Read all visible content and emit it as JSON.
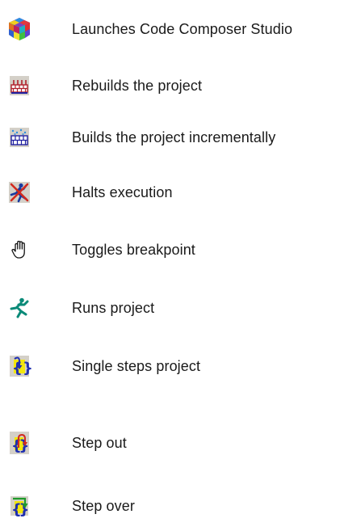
{
  "legend": {
    "items": [
      {
        "icon": "code-composer-studio-cube-icon",
        "label": "Launches Code Composer Studio"
      },
      {
        "icon": "rebuild-all-icon",
        "label": "Rebuilds the project"
      },
      {
        "icon": "incremental-build-icon",
        "label": "Builds the project incrementally"
      },
      {
        "icon": "halt-icon",
        "label": "Halts execution"
      },
      {
        "icon": "toggle-breakpoint-hand-icon",
        "label": "Toggles breakpoint"
      },
      {
        "icon": "run-icon",
        "label": "Runs project"
      },
      {
        "icon": "single-step-icon",
        "label": "Single steps project"
      },
      {
        "icon": "step-out-icon",
        "label": "Step out"
      },
      {
        "icon": "step-over-icon",
        "label": "Step over"
      }
    ]
  },
  "colors": {
    "text": "#1a1a1a",
    "icon_background": "#d4d0c8",
    "run_green": "#0a8a78",
    "step_yellow": "#f2e60c",
    "step_blue": "#1f2fb0",
    "arrow_red": "#d22a1e",
    "arrow_green": "#1e9a2a",
    "build_red": "#b0202a",
    "build_blue": "#2020a0"
  }
}
